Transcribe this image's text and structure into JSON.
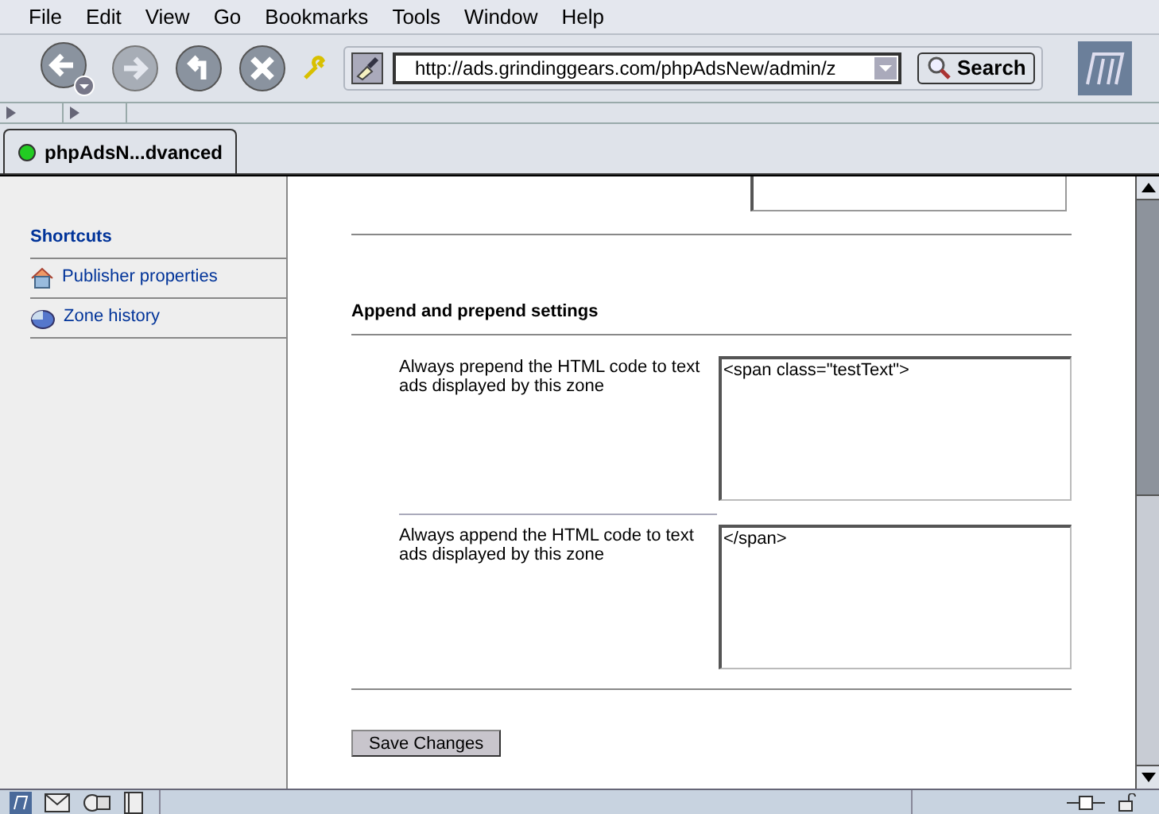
{
  "menu": [
    "File",
    "Edit",
    "View",
    "Go",
    "Bookmarks",
    "Tools",
    "Window",
    "Help"
  ],
  "url": "http://ads.grindinggears.com/phpAdsNew/admin/z",
  "search_button": "Search",
  "tabs": [
    {
      "label": "phpAdsN...dvanced",
      "selected": true
    }
  ],
  "sidebar": {
    "heading": "Shortcuts",
    "items": [
      {
        "label": "Publisher properties",
        "kind": "house"
      },
      {
        "label": "Zone history",
        "kind": "pie"
      }
    ]
  },
  "section_title": "Append and prepend settings",
  "fields": [
    {
      "label": "Always prepend the HTML code to text ads displayed by this zone",
      "value": "<span class=\"testText\">"
    },
    {
      "label": "Always append the HTML code to text ads displayed by this zone",
      "value": "</span>"
    }
  ],
  "save_button": "Save Changes"
}
